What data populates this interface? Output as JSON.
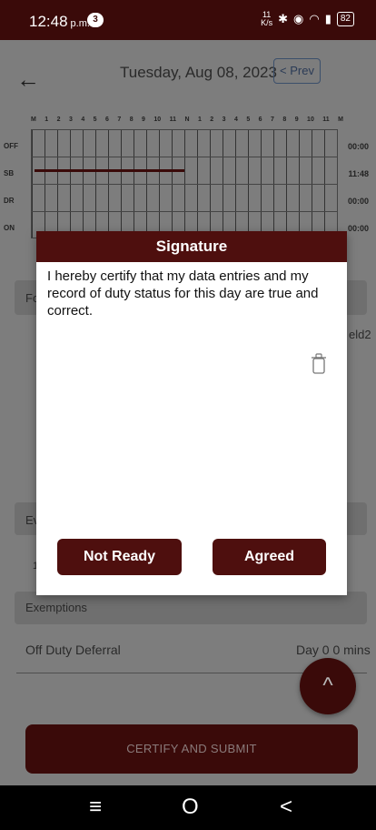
{
  "status": {
    "time": "12:48",
    "ampm": "p.m.",
    "notif_count": "3",
    "net_speed_top": "11",
    "net_speed_unit": "K/s",
    "battery": "82"
  },
  "header": {
    "date": "Tuesday, Aug 08, 2023",
    "prev_label": "< Prev"
  },
  "log_grid": {
    "hours": [
      "M",
      "1",
      "2",
      "3",
      "4",
      "5",
      "6",
      "7",
      "8",
      "9",
      "10",
      "11",
      "N",
      "1",
      "2",
      "3",
      "4",
      "5",
      "6",
      "7",
      "8",
      "9",
      "10",
      "11",
      "M"
    ],
    "rows": [
      {
        "label": "OFF",
        "total": "00:00"
      },
      {
        "label": "SB",
        "total": "11:48"
      },
      {
        "label": "DR",
        "total": "00:00"
      },
      {
        "label": "ON",
        "total": "00:00"
      }
    ]
  },
  "background": {
    "section_fo": "Fo",
    "side_text": "eld2",
    "section_ev": "Ev",
    "small_num": "1",
    "exemptions": "Exemptions",
    "off_duty_deferral": "Off Duty Deferral",
    "deferral_value": "Day 0 0 mins",
    "certify_label": "CERTIFY AND SUBMIT"
  },
  "modal": {
    "title": "Signature",
    "statement": "I hereby certify that my data entries and my record of duty status for this day are true and correct.",
    "not_ready_label": "Not Ready",
    "agreed_label": "Agreed"
  },
  "navbar": {
    "menu": "≡",
    "home": "O",
    "back": "<"
  },
  "colors": {
    "brand": "#4e0f0e",
    "statusbar": "#3a0a09"
  }
}
